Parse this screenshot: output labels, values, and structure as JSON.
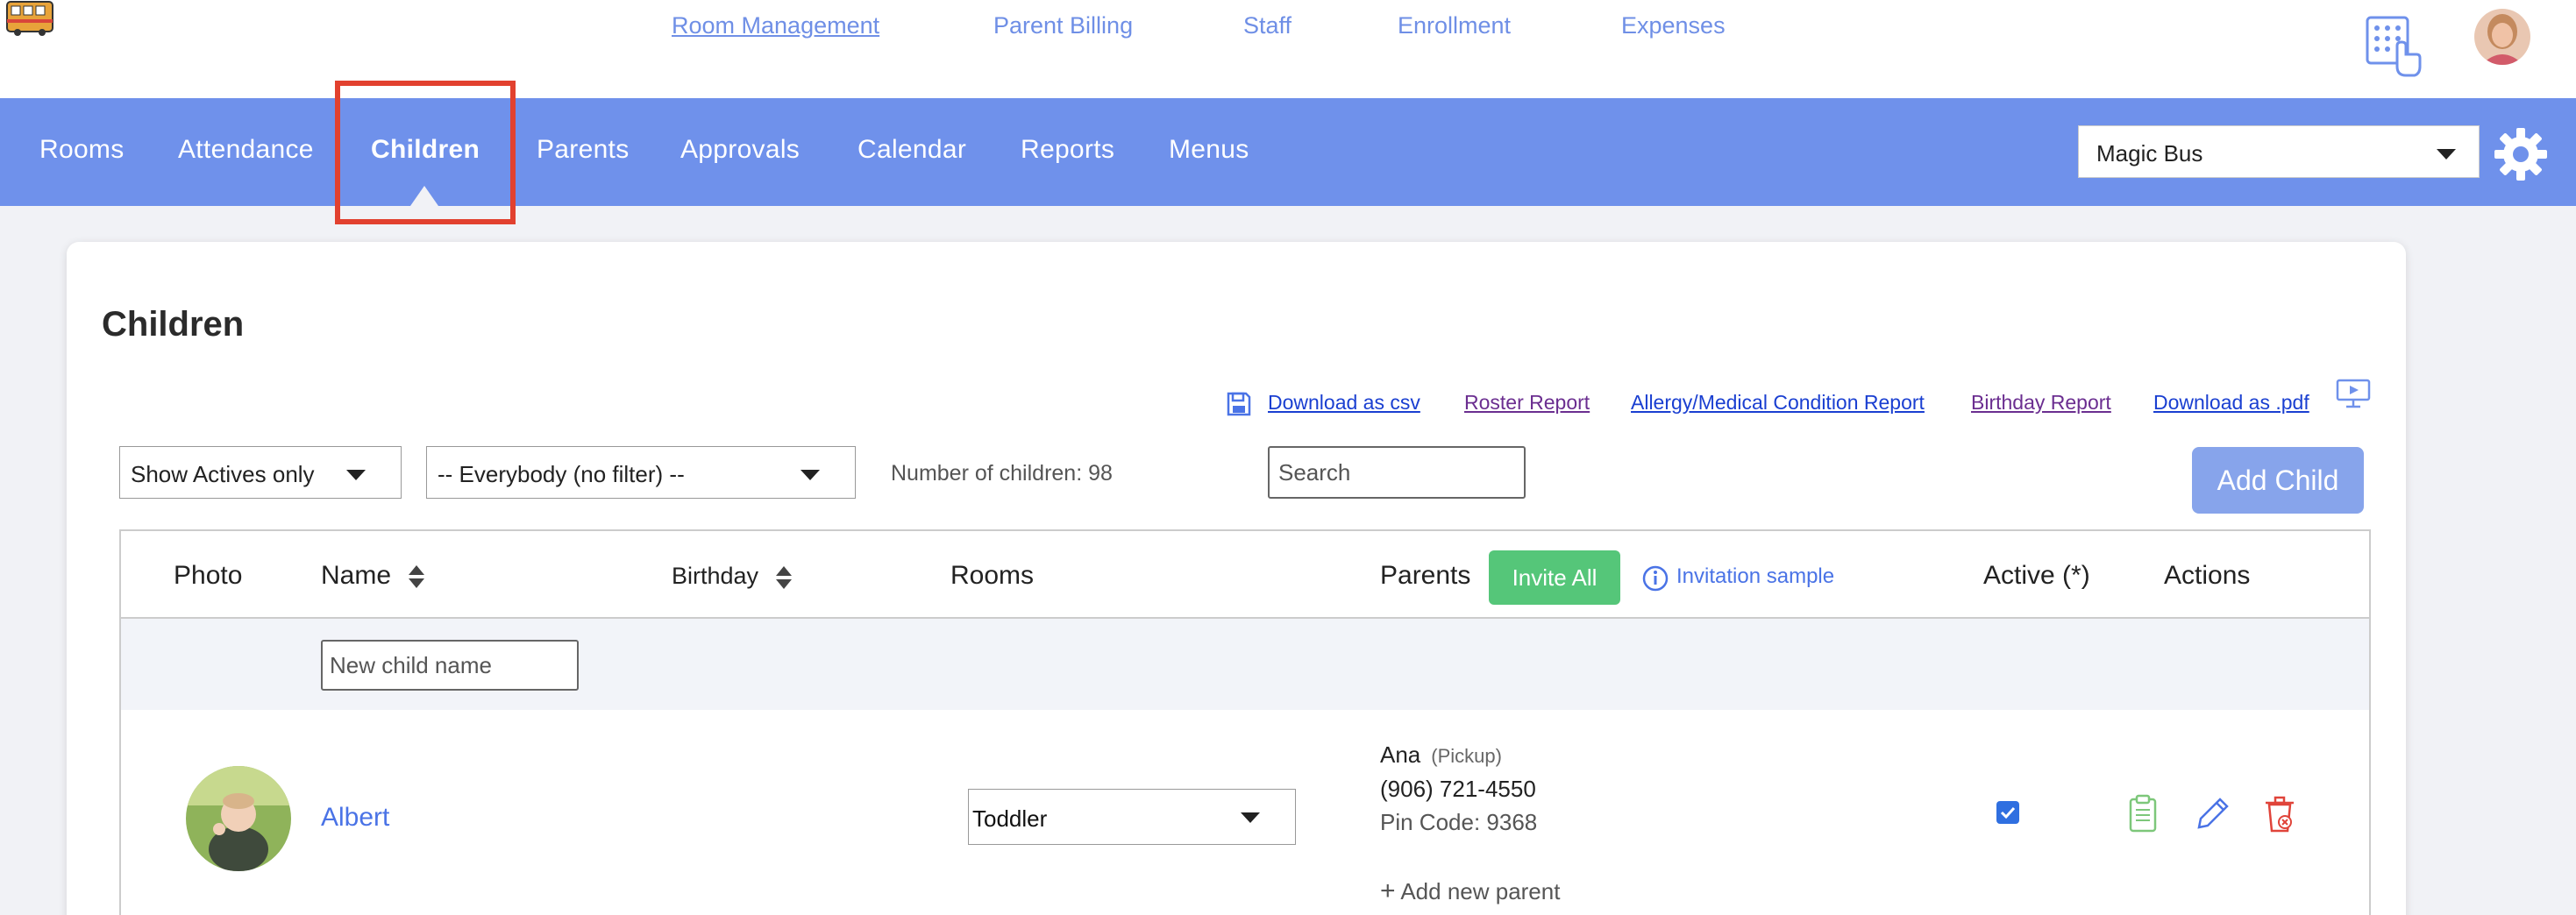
{
  "top_nav": {
    "links": [
      "Room Management",
      "Parent Billing",
      "Staff",
      "Enrollment",
      "Expenses"
    ]
  },
  "main_nav": {
    "items": [
      "Rooms",
      "Attendance",
      "Children",
      "Parents",
      "Approvals",
      "Calendar",
      "Reports",
      "Menus"
    ],
    "active": "Children"
  },
  "school_select": {
    "value": "Magic Bus"
  },
  "page": {
    "title": "Children"
  },
  "reports": {
    "download_csv": "Download as csv",
    "roster": "Roster Report",
    "allergy": "Allergy/Medical Condition Report",
    "birthday": "Birthday Report",
    "download_pdf": "Download as .pdf"
  },
  "filters": {
    "status": "Show Actives only",
    "group": "-- Everybody (no filter) --",
    "count_text": "Number of children: 98",
    "search_placeholder": "Search"
  },
  "add_child_label": "Add Child",
  "table": {
    "headers": {
      "photo": "Photo",
      "name": "Name",
      "birthday": "Birthday",
      "rooms": "Rooms",
      "parents": "Parents",
      "active": "Active (*)",
      "actions": "Actions"
    },
    "invite_all": "Invite All",
    "invitation_sample": "Invitation sample",
    "new_child_placeholder": "New child name",
    "rows": [
      {
        "name": "Albert",
        "room": "Toddler",
        "parent_name": "Ana",
        "parent_role": "(Pickup)",
        "parent_phone": "(906) 721-4550",
        "parent_pin": "Pin Code: 9368",
        "add_parent": "Add new parent",
        "active": true
      }
    ]
  },
  "colors": {
    "nav_bg": "#6f91eb",
    "link_blue": "#4a73e6",
    "invite_green": "#55c679",
    "highlight_red": "#e2412f",
    "add_button": "#87a4eb"
  }
}
